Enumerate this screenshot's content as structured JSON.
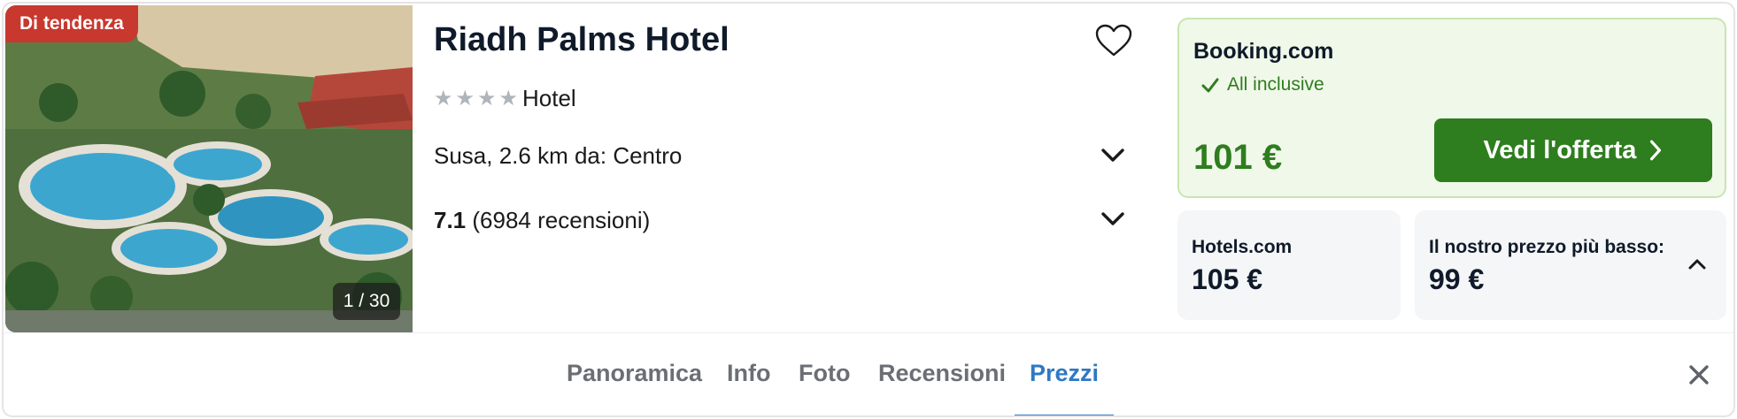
{
  "photo": {
    "badge": "Di tendenza",
    "counter": "1 / 30"
  },
  "hotel": {
    "name": "Riadh Palms Hotel",
    "star_rating": 4,
    "type": "Hotel",
    "location": "Susa, 2.6 km da: Centro",
    "rating_score": "7.1",
    "rating_reviews": "(6984 recensioni)"
  },
  "deal": {
    "provider": "Booking.com",
    "feature": "All inclusive",
    "price": "101 €",
    "button_label": "Vedi l'offerta"
  },
  "offers": [
    {
      "provider": "Hotels.com",
      "price": "105 €"
    },
    {
      "provider": "Il nostro prezzo più basso:",
      "price": "99 €"
    }
  ],
  "tabs": [
    {
      "label": "Panoramica",
      "active": false
    },
    {
      "label": "Info",
      "active": false
    },
    {
      "label": "Foto",
      "active": false
    },
    {
      "label": "Recensioni",
      "active": false
    },
    {
      "label": "Prezzi",
      "active": true
    }
  ],
  "icons": {
    "favorite": "heart-outline-icon",
    "expand": "chevron-down-icon",
    "collapse": "chevron-up-icon",
    "check": "check-icon",
    "arrow": "chevron-right-icon",
    "close": "close-icon"
  },
  "colors": {
    "badge": "#c8382f",
    "deal_green": "#2e7d1e",
    "deal_bg": "#f0f8e9",
    "tab_active": "#2f78c4"
  }
}
